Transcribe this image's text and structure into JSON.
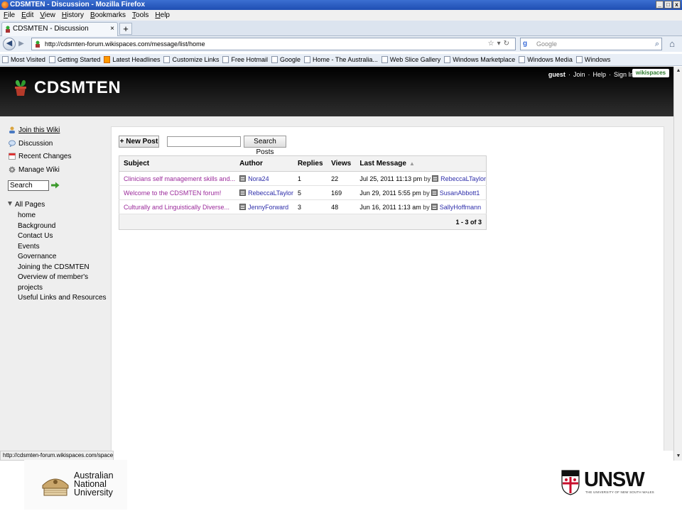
{
  "browser": {
    "window_title": "CDSMTEN - Discussion - Mozilla Firefox",
    "window_controls": [
      "_",
      "□",
      "x"
    ],
    "menu": [
      "File",
      "Edit",
      "View",
      "History",
      "Bookmarks",
      "Tools",
      "Help"
    ],
    "tab_title": "CDSMTEN - Discussion",
    "new_tab_label": "+",
    "tab_close": "×",
    "url": "http://cdsmten-forum.wikispaces.com/message/list/home",
    "search_engine_placeholder": "Google",
    "bookmarks": [
      "Most Visited",
      "Getting Started",
      "Latest Headlines",
      "Customize Links",
      "Free Hotmail",
      "Google",
      "Home - The Australia...",
      "Web Slice Gallery",
      "Windows Marketplace",
      "Windows Media",
      "Windows"
    ],
    "status_text": "http://cdsmten-forum.wikispaces.com/space/join"
  },
  "wiki": {
    "title": "CDSMTEN",
    "user_nav": {
      "guest": "guest",
      "join": "Join",
      "help": "Help",
      "sign_in": "Sign In",
      "separator": "·"
    },
    "brand_badge": "wikispaces"
  },
  "sidebar": {
    "links": [
      {
        "label": "Join this Wiki",
        "icon": "user-icon"
      },
      {
        "label": "Discussion",
        "icon": "speech-bubble-icon"
      },
      {
        "label": "Recent Changes",
        "icon": "calendar-icon"
      },
      {
        "label": "Manage Wiki",
        "icon": "gear-icon"
      }
    ],
    "search_value": "Search",
    "all_pages_label": "All Pages",
    "pages": [
      "home",
      "Background",
      "Contact Us",
      "Events",
      "Governance",
      "Joining the CDSMTEN",
      "Overview of member's projects",
      "Useful Links and Resources"
    ]
  },
  "discussion": {
    "new_post_label": "+ New Post",
    "search_button_label": "Search Posts",
    "columns": [
      "Subject",
      "Author",
      "Replies",
      "Views",
      "Last Message"
    ],
    "by_label": "by",
    "rows": [
      {
        "subject": "Clinicians self management skills and...",
        "author": "Nora24",
        "replies": "1",
        "views": "22",
        "last_date": "Jul 25, 2011 11:13 pm",
        "last_by": "RebeccaLTaylor"
      },
      {
        "subject": "Welcome to the CDSMTEN forum!",
        "author": "RebeccaLTaylor",
        "replies": "5",
        "views": "169",
        "last_date": "Jun 29, 2011 5:55 pm",
        "last_by": "SusanAbbott1"
      },
      {
        "subject": "Culturally and Linguistically Diverse...",
        "author": "JennyForward",
        "replies": "3",
        "views": "48",
        "last_date": "Jun 16, 2011 1:13 am",
        "last_by": "SallyHoffmann"
      }
    ],
    "pagination": "1 - 3 of 3"
  },
  "footer": {
    "anu_lines": [
      "Australian",
      "National",
      "University"
    ],
    "unsw_word": "UNSW",
    "unsw_sub": "THE UNIVERSITY OF NEW SOUTH WALES"
  },
  "colors": {
    "subject_link": "#9b2a9b",
    "user_link": "#2e2eaa",
    "header_bg": "#000000",
    "page_bg": "#eeeeee"
  }
}
